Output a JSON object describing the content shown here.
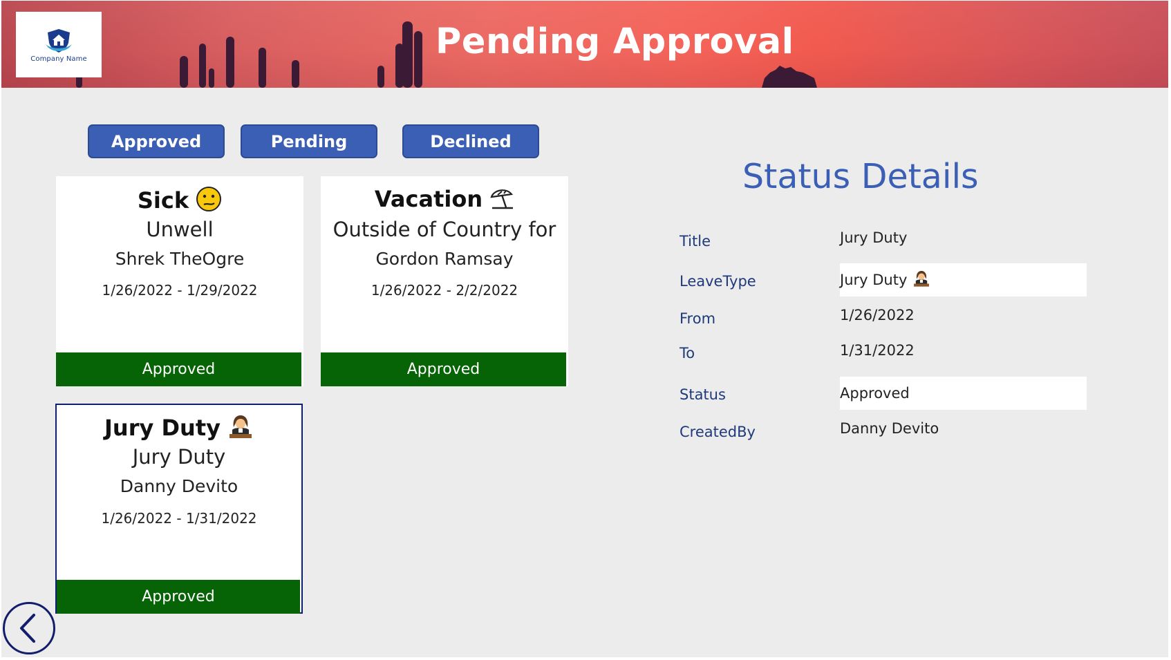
{
  "header": {
    "title": "Pending Approval",
    "logo_text": "Company Name"
  },
  "filters": [
    {
      "label": "Approved"
    },
    {
      "label": "Pending"
    },
    {
      "label": "Declined"
    }
  ],
  "cards": [
    {
      "title": "Sick",
      "emoji_icon": "confused-face-icon",
      "reason": "Unwell",
      "name": "Shrek TheOgre",
      "dates": "1/26/2022 - 1/29/2022",
      "status": "Approved"
    },
    {
      "title": "Vacation",
      "emoji_icon": "beach-umbrella-icon",
      "reason": "Outside of Country for",
      "name": "Gordon Ramsay",
      "dates": "1/26/2022 - 2/2/2022",
      "status": "Approved"
    },
    {
      "title": "Jury Duty",
      "emoji_icon": "judge-icon",
      "reason": "Jury Duty",
      "name": "Danny Devito",
      "dates": "1/26/2022 - 1/31/2022",
      "status": "Approved"
    }
  ],
  "details": {
    "heading": "Status Details",
    "title_label": "Title",
    "title_value": "Jury Duty",
    "leavetype_label": "LeaveType",
    "leavetype_value": "Jury Duty",
    "from_label": "From",
    "from_value": "1/26/2022",
    "to_label": "To",
    "to_value": "1/31/2022",
    "status_label": "Status",
    "status_value": "Approved",
    "createdby_label": "CreatedBy",
    "createdby_value": "Danny Devito"
  },
  "colors": {
    "primary_button": "#3b5fb4",
    "status_approved": "#066406",
    "selected_border": "#0d1f6e",
    "label_text": "#1f3a7a"
  },
  "icons": {
    "back": "chevron-left-icon",
    "logo": "house-shield-icon"
  }
}
